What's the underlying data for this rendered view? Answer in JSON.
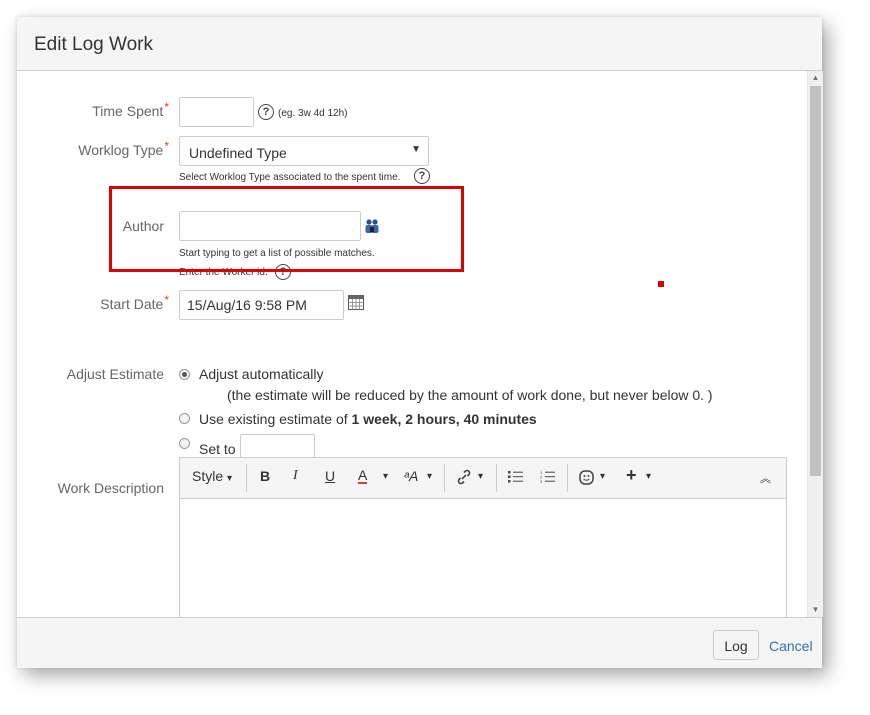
{
  "dialog": {
    "title": "Edit Log Work"
  },
  "form": {
    "time_spent": {
      "label": "Time Spent",
      "required": "*",
      "value": "",
      "help": "(eg. 3w 4d 12h)",
      "help_icon": "?"
    },
    "worklog_type": {
      "label": "Worklog Type",
      "required": "*",
      "selected": "Undefined Type",
      "caret": "▼",
      "help": "Select Worklog Type associated to the spent time.",
      "help_icon": "?"
    },
    "author": {
      "label": "Author",
      "value": "",
      "help_line1": "Start typing to get a list of possible matches.",
      "help_line2": "Enter the Worker id.",
      "help_icon": "?",
      "picker_icon": "user-picker-icon"
    },
    "start_date": {
      "label": "Start Date",
      "required": "*",
      "value": "15/Aug/16 9:58 PM",
      "calendar_icon": "calendar-icon"
    },
    "adjust_estimate": {
      "label": "Adjust Estimate",
      "options": [
        {
          "label": "Adjust automatically",
          "note": "(the estimate will be reduced by the amount of work done, but never below 0. )",
          "checked": true
        },
        {
          "label_prefix": "Use existing estimate of ",
          "label_bold": "1 week, 2 hours, 40 minutes",
          "checked": false
        },
        {
          "label": "Set to",
          "value": "",
          "checked": false
        }
      ]
    },
    "work_description": {
      "label": "Work Description",
      "toolbar": {
        "style": "Style",
        "bold": "B",
        "italic": "I",
        "underline": "U",
        "text_color": "A",
        "text_effects": "ᵃA",
        "caret": "▾",
        "link_icon": "link-icon",
        "bullet_list_icon": "bullet-list-icon",
        "numbered_list_icon": "numbered-list-icon",
        "emoticon_icon": "emoticon-icon",
        "insert_more": "+",
        "collapse": "︽"
      },
      "value": ""
    }
  },
  "footer": {
    "log_label": "Log",
    "cancel_label": "Cancel"
  },
  "colors": {
    "required": "#d04437",
    "highlight": "#dd0000",
    "link": "#3572b0"
  }
}
